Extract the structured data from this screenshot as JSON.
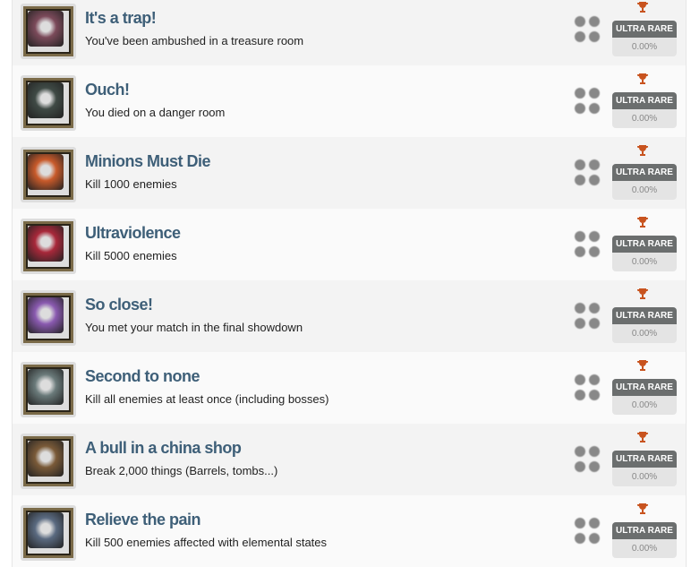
{
  "colors": {
    "title": "#3e5f78",
    "trophy": "#c8531e",
    "badge": "#6b6e6e"
  },
  "achievements": [
    {
      "title": "It's a trap!",
      "description": "You've been ambushed in a treasure room",
      "rarity": "ULTRA RARE",
      "percent": "0.00%",
      "icon": "treasure-chest-icon",
      "art": "#7b4a5a"
    },
    {
      "title": "Ouch!",
      "description": "You died on a danger room",
      "rarity": "ULTRA RARE",
      "percent": "0.00%",
      "icon": "skull-door-icon",
      "art": "#3f4a45"
    },
    {
      "title": "Minions Must Die",
      "description": "Kill 1000 enemies",
      "rarity": "ULTRA RARE",
      "percent": "0.00%",
      "icon": "minion-icon",
      "art": "#c85a2a"
    },
    {
      "title": "Ultraviolence",
      "description": "Kill 5000 enemies",
      "rarity": "ULTRA RARE",
      "percent": "0.00%",
      "icon": "demon-face-icon",
      "art": "#a8283a"
    },
    {
      "title": "So close!",
      "description": "You met your match in the final showdown",
      "rarity": "ULTRA RARE",
      "percent": "0.00%",
      "icon": "mask-icon",
      "art": "#8a5ab0"
    },
    {
      "title": "Second to none",
      "description": "Kill all enemies at least once (including bosses)",
      "rarity": "ULTRA RARE",
      "percent": "0.00%",
      "icon": "skull-icon",
      "art": "#6a7a7a"
    },
    {
      "title": "A bull in a china shop",
      "description": "Break 2,000 things (Barrels, tombs...)",
      "rarity": "ULTRA RARE",
      "percent": "0.00%",
      "icon": "barrel-icon",
      "art": "#7a5a38"
    },
    {
      "title": "Relieve the pain",
      "description": "Kill 500 enemies affected with elemental states",
      "rarity": "ULTRA RARE",
      "percent": "0.00%",
      "icon": "skeleton-icon",
      "art": "#5a6a80"
    }
  ]
}
